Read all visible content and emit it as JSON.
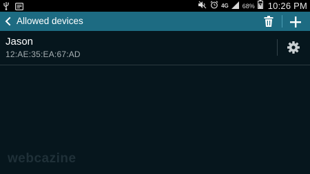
{
  "status_bar": {
    "icons_left": [
      "usb-icon",
      "notification-icon"
    ],
    "icons_right": [
      "mute-icon",
      "alarm-icon",
      "4g-icon",
      "signal-icon",
      "battery-icon"
    ],
    "network_type": "4G",
    "battery_percent": "68%",
    "time": "10:26 PM"
  },
  "action_bar": {
    "title": "Allowed devices",
    "back_icon": "back-chevron-icon",
    "delete_icon": "trash-icon",
    "add_icon": "plus-icon",
    "color": "#1d6b82"
  },
  "devices": [
    {
      "name": "Jason",
      "mac": "12:AE:35:EA:67:AD",
      "settings_icon": "gear-icon"
    }
  ],
  "watermark": "webcazine",
  "colors": {
    "background": "#06161d",
    "status_bar": "#000000",
    "action_bar": "#1d6b82",
    "secondary_text": "#a7b0b3"
  }
}
